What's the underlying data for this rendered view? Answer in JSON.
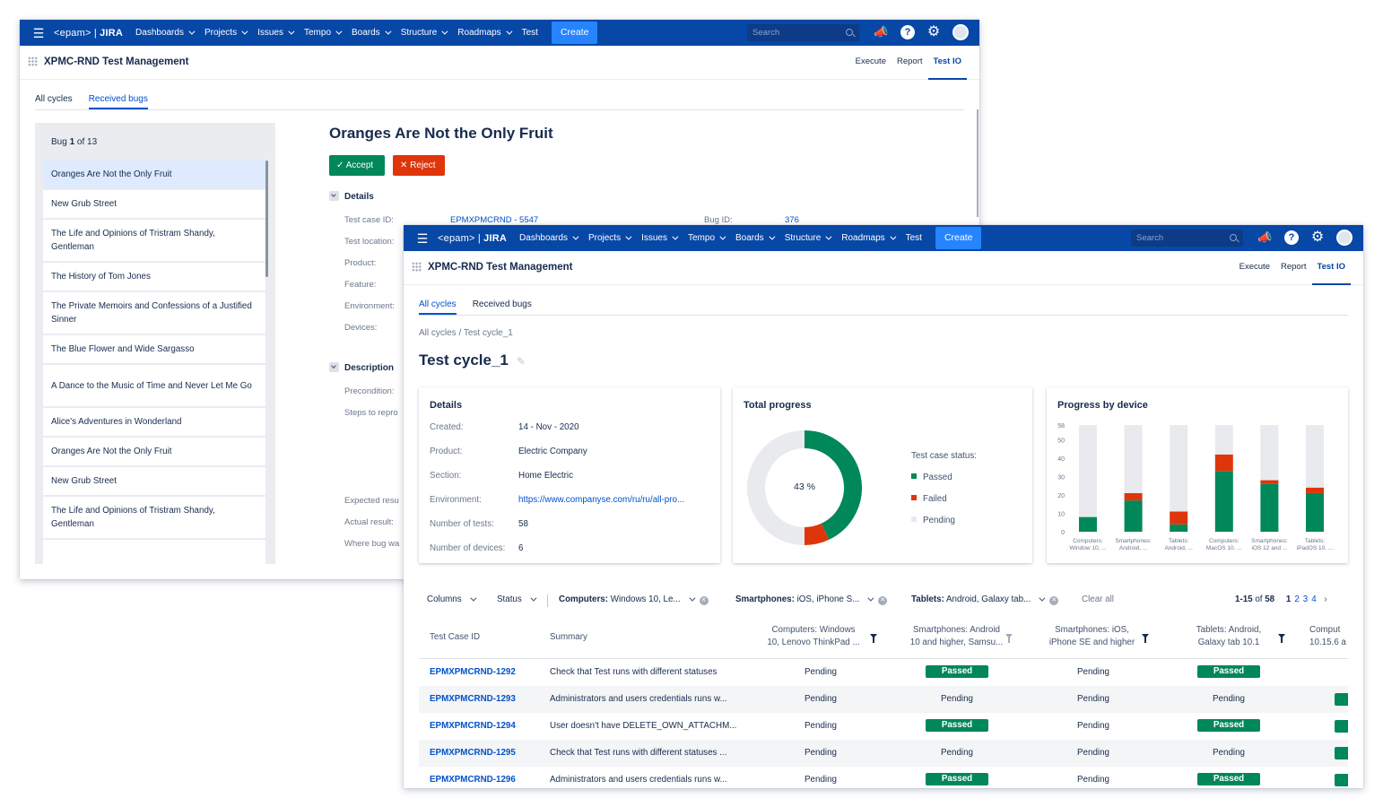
{
  "nav": {
    "logo_main": "<epam>",
    "logo_sep": " | ",
    "logo_jira": "JIRA",
    "items": [
      "Dashboards",
      "Projects",
      "Issues",
      "Tempo",
      "Boards",
      "Structure",
      "Roadmaps"
    ],
    "test": "Test",
    "create": "Create",
    "search_placeholder": "Search"
  },
  "project": {
    "title": "XPMC-RND Test Management",
    "tabs": [
      "Execute",
      "Report",
      "Test IO"
    ]
  },
  "back": {
    "subtabs": [
      "All cycles",
      "Received bugs"
    ],
    "bug_count_prefix": "Bug ",
    "bug_count_num": "1",
    "bug_count_suffix": " of 13",
    "bugs": [
      "Oranges Are Not the Only Fruit",
      "New Grub Street",
      "The Life and Opinions of Tristram Shandy, Gentleman",
      "The History of Tom Jones",
      "The Private Memoirs and Confessions of a Justified Sinner",
      "The Blue Flower and Wide Sargasso",
      "A Dance to the Music of Time and Never Let Me Go",
      "Alice's Adventures in Wonderland",
      "Oranges Are Not the Only Fruit",
      "New Grub Street",
      "The Life and Opinions of Tristram Shandy, Gentleman"
    ],
    "bug_title": "Oranges Are Not the Only Fruit",
    "accept": "Accept",
    "reject": "Reject",
    "details_head": "Details",
    "test_case_id_label": "Test case ID:",
    "test_case_id_value": "EPMXPMCRND - 5547",
    "bug_id_label": "Bug ID:",
    "bug_id_value": "376",
    "detail_labels": [
      "Test location:",
      "Product:",
      "Feature:",
      "Environment:",
      "Devices:"
    ],
    "description_head": "Description",
    "desc_labels": [
      "Precondition:",
      "Steps to repro"
    ],
    "result_labels": [
      "Expected resu",
      "Actual result:",
      "Where bug wa"
    ]
  },
  "front": {
    "subtabs": [
      "All cycles",
      "Received bugs"
    ],
    "breadcrumb": "All cycles  /  Test cycle_1",
    "title": "Test cycle_1",
    "details": {
      "title": "Details",
      "rows": [
        {
          "label": "Created:",
          "value": "14 - Nov - 2020"
        },
        {
          "label": "Product:",
          "value": "Electric Company"
        },
        {
          "label": "Section:",
          "value": "Home Electric"
        },
        {
          "label": "Environment:",
          "value": "https://www.companyse.com/ru/ru/all-pro..."
        },
        {
          "label": "Number of tests:",
          "value": "58"
        },
        {
          "label": "Number of devices:",
          "value": "6"
        }
      ]
    },
    "progress": {
      "title": "Total progress",
      "center_label": "43 %",
      "legend_title": "Test case status:",
      "legend": [
        "Passed",
        "Failed",
        "Pending"
      ]
    },
    "device": {
      "title": "Progress by device"
    },
    "filters": {
      "columns": "Columns",
      "status": "Status",
      "computers_key": "Computers:",
      "computers_val": " Windows 10, Le...",
      "smartphones_key": "Smartphones:",
      "smartphones_val": " iOS, iPhone S...",
      "tablets_key": "Tablets:",
      "tablets_val": " Android, Galaxy tab...",
      "clear": "Clear all",
      "range": "1-15",
      "of": " of ",
      "total": "58",
      "pages": [
        "1",
        "2",
        "3",
        "4"
      ]
    },
    "table": {
      "h_id": "Test Case ID",
      "h_summary": "Summary",
      "h_computers_1": "Computers: Windows",
      "h_computers_2": "10, Lenovo ThinkPad ...",
      "h_smart_android_1": "Smartphones: Android",
      "h_smart_android_2": "10 and higher, Samsu...",
      "h_smart_ios_1": "Smartphones: iOS,",
      "h_smart_ios_2": "iPhone SE and higher",
      "h_tablets_1": "Tablets: Android,",
      "h_tablets_2": "Galaxy tab 10.1",
      "h_computers_mac_1": "Comput",
      "h_computers_mac_2": "10.15.6 a",
      "rows": [
        {
          "id": "EPMXPMCRND-1292",
          "summary": "Check that Test runs with different statuses",
          "c1": "Pending",
          "c2": "Passed",
          "c3": "Pending",
          "c4": "Passed"
        },
        {
          "id": "EPMXPMCRND-1293",
          "summary": "Administrators and users credentials runs w...",
          "c1": "Pending",
          "c2": "Pending",
          "c3": "Pending",
          "c4": "Pending"
        },
        {
          "id": "EPMXPMCRND-1294",
          "summary": "User doesn't have DELETE_OWN_ATTACHM...",
          "c1": "Pending",
          "c2": "Passed",
          "c3": "Pending",
          "c4": "Passed"
        },
        {
          "id": "EPMXPMCRND-1295",
          "summary": "Check that Test runs with different statuses ...",
          "c1": "Pending",
          "c2": "Pending",
          "c3": "Pending",
          "c4": "Pending"
        },
        {
          "id": "EPMXPMCRND-1296",
          "summary": "Administrators and users credentials runs w...",
          "c1": "Pending",
          "c2": "Passed",
          "c3": "Pending",
          "c4": "Passed"
        }
      ]
    }
  },
  "colors": {
    "nav": "#0747a6",
    "passed": "#00875a",
    "failed": "#de350b",
    "pending": "#e9eaed",
    "link": "#0052cc"
  },
  "chart_data": [
    {
      "type": "pie",
      "title": "Total progress",
      "categories": [
        "Passed",
        "Failed",
        "Pending"
      ],
      "values": [
        43,
        7,
        50
      ],
      "center_label": "43 %"
    },
    {
      "type": "bar",
      "title": "Progress by device",
      "stacked": true,
      "categories": [
        "Computers: Window 10, ...",
        "Smartphones: Android, ...",
        "Tablets: Android, ...",
        "Computers: MacOS 10. ...",
        "Smartphones: iOS 12 and ...",
        "Tablets: iPadOS 10. ..."
      ],
      "series": [
        {
          "name": "Passed",
          "values": [
            8,
            17,
            4,
            33,
            26,
            21
          ]
        },
        {
          "name": "Failed",
          "values": [
            0,
            4,
            7,
            9,
            2,
            3
          ]
        },
        {
          "name": "Pending",
          "values": [
            50,
            37,
            47,
            16,
            30,
            34
          ]
        }
      ],
      "yticks": [
        0,
        10,
        20,
        30,
        40,
        50,
        58
      ],
      "ylim": [
        0,
        58
      ],
      "grid": false
    }
  ]
}
